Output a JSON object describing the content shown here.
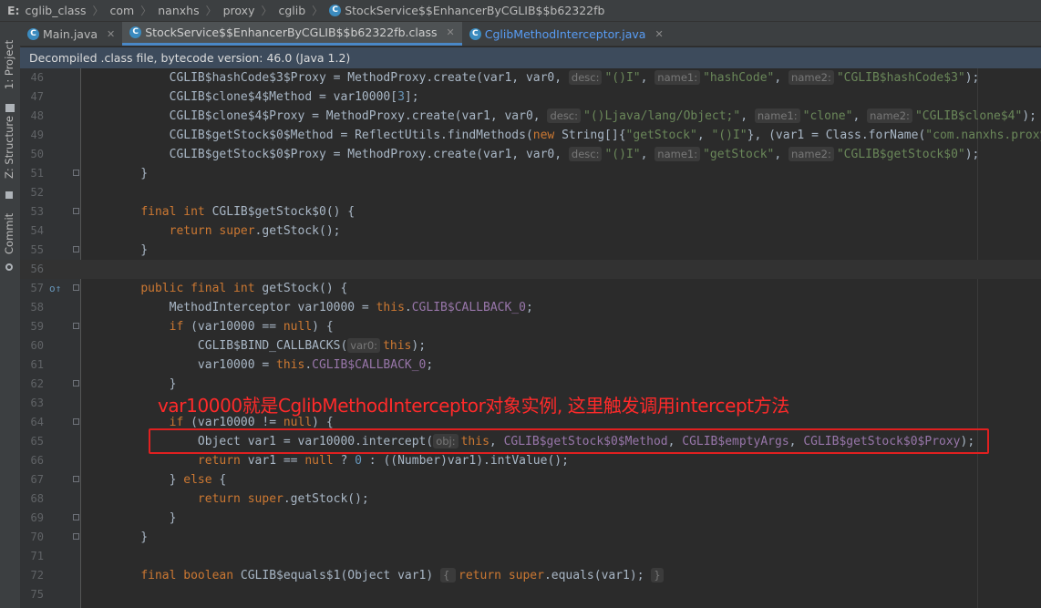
{
  "breadcrumb": {
    "drive": "E:",
    "items": [
      "cglib_class",
      "com",
      "nanxhs",
      "proxy",
      "cglib"
    ],
    "file": "StockService$$EnhancerByCGLIB$$b62322fb",
    "file_badge": "C"
  },
  "tabs": [
    {
      "label": "Main.java",
      "badge": "C",
      "state": "normal"
    },
    {
      "label": "StockService$$EnhancerByCGLIB$$b62322fb.class",
      "badge": "C",
      "state": "active"
    },
    {
      "label": "CglibMethodInterceptor.java",
      "badge": "C",
      "state": "link"
    }
  ],
  "tool_strip": {
    "project": "1: Project",
    "structure": "Z: Structure",
    "commit": "Commit"
  },
  "banner": "Decompiled .class file, bytecode version: 46.0 (Java 1.2)",
  "annotation": "var10000就是CglibMethodInterceptor对象实例, 这里触发调用intercept方法",
  "colors": {
    "keyword": "#cc7832",
    "field": "#9876aa",
    "string": "#6a8759",
    "number": "#6897bb",
    "annotation": "#ff2a2a",
    "highlight_box": "#e02020"
  },
  "code_lines": [
    {
      "n": "46",
      "fold": false,
      "marker": "",
      "segs": [
        [
          "        CGLIB$hashCode$3$Proxy = MethodProxy.create(var1, var0, ",
          ""
        ],
        [
          "desc:",
          "h"
        ],
        [
          "\"()I\"",
          "s"
        ],
        [
          ", ",
          ""
        ],
        [
          "name1:",
          "h"
        ],
        [
          "\"hashCode\"",
          "s"
        ],
        [
          ", ",
          ""
        ],
        [
          "name2:",
          "h"
        ],
        [
          "\"CGLIB$hashCode$3\"",
          "s"
        ],
        [
          ");",
          ""
        ]
      ]
    },
    {
      "n": "47",
      "fold": false,
      "marker": "",
      "segs": [
        [
          "        CGLIB$clone$4$Method = var10000[",
          ""
        ],
        [
          "3",
          "n"
        ],
        [
          "];",
          ""
        ]
      ]
    },
    {
      "n": "48",
      "fold": false,
      "marker": "",
      "segs": [
        [
          "        CGLIB$clone$4$Proxy = MethodProxy.create(var1, var0, ",
          ""
        ],
        [
          "desc:",
          "h"
        ],
        [
          "\"()Ljava/lang/Object;\"",
          "s"
        ],
        [
          ", ",
          ""
        ],
        [
          "name1:",
          "h"
        ],
        [
          "\"clone\"",
          "s"
        ],
        [
          ", ",
          ""
        ],
        [
          "name2:",
          "h"
        ],
        [
          "\"CGLIB$clone$4\"",
          "s"
        ],
        [
          ");",
          ""
        ]
      ]
    },
    {
      "n": "49",
      "fold": false,
      "marker": "",
      "segs": [
        [
          "        CGLIB$getStock$0$Method = ReflectUtils.findMethods(",
          ""
        ],
        [
          "new ",
          "k"
        ],
        [
          "String[]{",
          ""
        ],
        [
          "\"getStock\"",
          "s"
        ],
        [
          ", ",
          ""
        ],
        [
          "\"()I\"",
          "s"
        ],
        [
          "}, (var1 = Class.forName(",
          ""
        ],
        [
          "\"com.nanxhs.proxy",
          "s"
        ]
      ]
    },
    {
      "n": "50",
      "fold": false,
      "marker": "",
      "segs": [
        [
          "        CGLIB$getStock$0$Proxy = MethodProxy.create(var1, var0, ",
          ""
        ],
        [
          "desc:",
          "h"
        ],
        [
          "\"()I\"",
          "s"
        ],
        [
          ", ",
          ""
        ],
        [
          "name1:",
          "h"
        ],
        [
          "\"getStock\"",
          "s"
        ],
        [
          ", ",
          ""
        ],
        [
          "name2:",
          "h"
        ],
        [
          "\"CGLIB$getStock$0\"",
          "s"
        ],
        [
          ");",
          ""
        ]
      ]
    },
    {
      "n": "51",
      "fold": true,
      "marker": "",
      "segs": [
        [
          "    }",
          ""
        ]
      ]
    },
    {
      "n": "52",
      "fold": false,
      "marker": "",
      "segs": [
        [
          "",
          ""
        ]
      ]
    },
    {
      "n": "53",
      "fold": true,
      "marker": "",
      "segs": [
        [
          "    ",
          ""
        ],
        [
          "final int ",
          "k"
        ],
        [
          "CGLIB$getStock$0() {",
          ""
        ]
      ]
    },
    {
      "n": "54",
      "fold": false,
      "marker": "",
      "segs": [
        [
          "        ",
          ""
        ],
        [
          "return super",
          "k"
        ],
        [
          ".getStock();",
          ""
        ]
      ]
    },
    {
      "n": "55",
      "fold": true,
      "marker": "",
      "segs": [
        [
          "    }",
          ""
        ]
      ]
    },
    {
      "n": "56",
      "fold": false,
      "marker": "",
      "cur": true,
      "segs": [
        [
          "",
          ""
        ]
      ]
    },
    {
      "n": "57",
      "fold": true,
      "marker": "o↑",
      "segs": [
        [
          "    ",
          ""
        ],
        [
          "public final int ",
          "k"
        ],
        [
          "getStock() {",
          ""
        ]
      ]
    },
    {
      "n": "58",
      "fold": false,
      "marker": "",
      "segs": [
        [
          "        MethodInterceptor var10000 = ",
          ""
        ],
        [
          "this",
          "k"
        ],
        [
          ".",
          ""
        ],
        [
          "CGLIB$CALLBACK_0",
          "f"
        ],
        [
          ";",
          ""
        ]
      ]
    },
    {
      "n": "59",
      "fold": true,
      "marker": "",
      "segs": [
        [
          "        ",
          ""
        ],
        [
          "if ",
          "k"
        ],
        [
          "(var10000 == ",
          ""
        ],
        [
          "null",
          "k"
        ],
        [
          ") {",
          ""
        ]
      ]
    },
    {
      "n": "60",
      "fold": false,
      "marker": "",
      "segs": [
        [
          "            CGLIB$BIND_CALLBACKS(",
          ""
        ],
        [
          "var0:",
          "h"
        ],
        [
          "this",
          "k"
        ],
        [
          ");",
          ""
        ]
      ]
    },
    {
      "n": "61",
      "fold": false,
      "marker": "",
      "segs": [
        [
          "            var10000 = ",
          ""
        ],
        [
          "this",
          "k"
        ],
        [
          ".",
          ""
        ],
        [
          "CGLIB$CALLBACK_0",
          "f"
        ],
        [
          ";",
          ""
        ]
      ]
    },
    {
      "n": "62",
      "fold": true,
      "marker": "",
      "segs": [
        [
          "        }",
          ""
        ]
      ]
    },
    {
      "n": "63",
      "fold": false,
      "marker": "",
      "segs": [
        [
          "",
          ""
        ]
      ]
    },
    {
      "n": "64",
      "fold": true,
      "marker": "",
      "segs": [
        [
          "        ",
          ""
        ],
        [
          "if ",
          "k"
        ],
        [
          "(var10000 != ",
          ""
        ],
        [
          "null",
          "k"
        ],
        [
          ") {",
          ""
        ]
      ]
    },
    {
      "n": "65",
      "fold": false,
      "marker": "",
      "segs": [
        [
          "            Object var1 = var10000.intercept(",
          ""
        ],
        [
          "obj:",
          "h"
        ],
        [
          "this",
          "k"
        ],
        [
          ", ",
          ""
        ],
        [
          "CGLIB$getStock$0$Method",
          "f"
        ],
        [
          ", ",
          ""
        ],
        [
          "CGLIB$emptyArgs",
          "f"
        ],
        [
          ", ",
          ""
        ],
        [
          "CGLIB$getStock$0$Proxy",
          "f"
        ],
        [
          ");",
          ""
        ]
      ]
    },
    {
      "n": "66",
      "fold": false,
      "marker": "",
      "segs": [
        [
          "            ",
          ""
        ],
        [
          "return ",
          "k"
        ],
        [
          "var1 == ",
          ""
        ],
        [
          "null ",
          "k"
        ],
        [
          "? ",
          ""
        ],
        [
          "0 ",
          "n"
        ],
        [
          ": ((Number)var1).intValue();",
          ""
        ]
      ]
    },
    {
      "n": "67",
      "fold": true,
      "marker": "",
      "segs": [
        [
          "        } ",
          ""
        ],
        [
          "else ",
          "k"
        ],
        [
          "{",
          ""
        ]
      ]
    },
    {
      "n": "68",
      "fold": false,
      "marker": "",
      "segs": [
        [
          "            ",
          ""
        ],
        [
          "return super",
          "k"
        ],
        [
          ".getStock();",
          ""
        ]
      ]
    },
    {
      "n": "69",
      "fold": true,
      "marker": "",
      "segs": [
        [
          "        }",
          ""
        ]
      ]
    },
    {
      "n": "70",
      "fold": true,
      "marker": "",
      "segs": [
        [
          "    }",
          ""
        ]
      ]
    },
    {
      "n": "71",
      "fold": false,
      "marker": "",
      "segs": [
        [
          "",
          ""
        ]
      ]
    },
    {
      "n": "72",
      "fold": false,
      "marker": "",
      "segs": [
        [
          "    ",
          ""
        ],
        [
          "final boolean ",
          "k"
        ],
        [
          "CGLIB$equals$1(Object var1) ",
          ""
        ],
        [
          "{ ",
          "h"
        ],
        [
          "return super",
          "k"
        ],
        [
          ".equals(var1); ",
          ""
        ],
        [
          "}",
          "h"
        ]
      ]
    },
    {
      "n": "75",
      "fold": false,
      "marker": "",
      "segs": [
        [
          "",
          ""
        ]
      ]
    }
  ]
}
